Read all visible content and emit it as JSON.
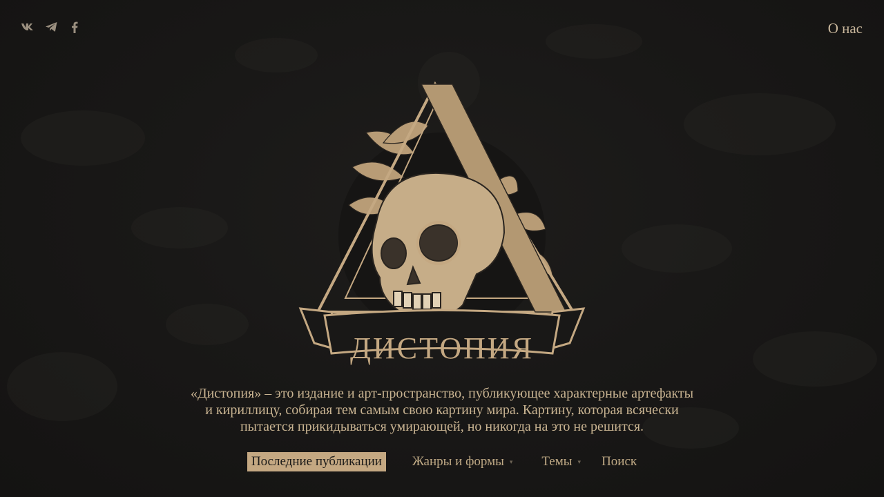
{
  "header": {
    "social": [
      {
        "name": "vk-icon"
      },
      {
        "name": "telegram-icon"
      },
      {
        "name": "facebook-icon"
      }
    ],
    "about_label": "О нас"
  },
  "logo": {
    "brand_name": "ДИСТОПИЯ"
  },
  "description": {
    "lines": [
      "«Дистопия» – это издание и арт-пространство, публикующее характерные артефакты",
      "и кириллицу, собирая тем самым свою картину мира. Картину, которая всячески",
      "пытается прикидываться умирающей, но никогда на это не решится."
    ]
  },
  "nav": {
    "items": [
      {
        "label": "Последние публикации",
        "active": true
      },
      {
        "label": "Жанры и формы",
        "dropdown": true
      },
      {
        "label": "Темы",
        "dropdown": true
      },
      {
        "label": "Поиск"
      }
    ],
    "caret": "▾"
  },
  "colors": {
    "background": "#1b1a19",
    "accent": "#c4a882",
    "text": "#c8b391"
  }
}
